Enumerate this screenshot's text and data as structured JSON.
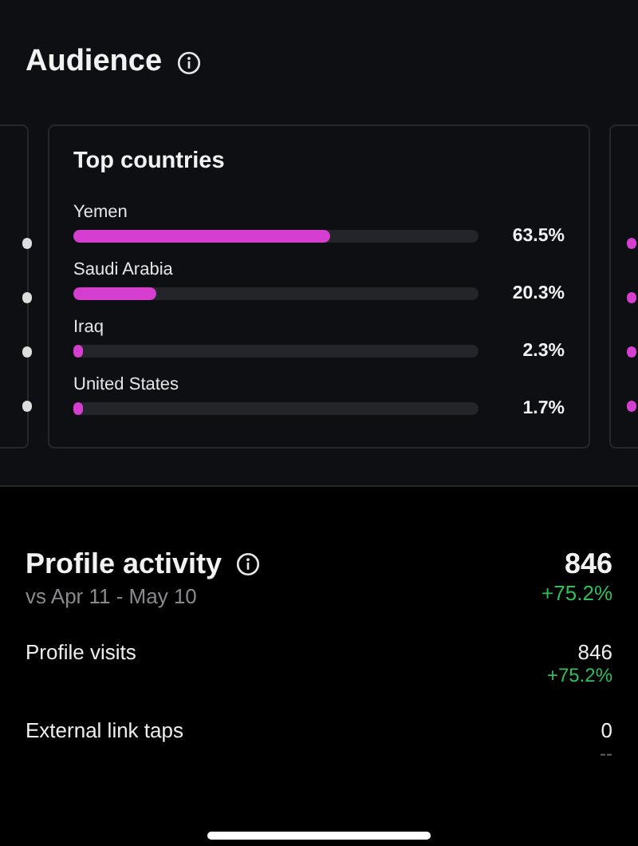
{
  "audience": {
    "title": "Audience",
    "top_countries": {
      "title": "Top countries",
      "rows": [
        {
          "name": "Yemen",
          "level": 0.635,
          "reading": "63.5%"
        },
        {
          "name": "Saudi Arabia",
          "level": 0.203,
          "reading": "20.3%"
        },
        {
          "name": "Iraq",
          "level": 0.023,
          "reading": "2.3%"
        },
        {
          "name": "United States",
          "level": 0.017,
          "reading": "1.7%"
        }
      ]
    }
  },
  "profile_activity": {
    "title": "Profile activity",
    "subtitle": "vs Apr 11 - May 10",
    "total": "846",
    "change": "+75.2%",
    "color": "#2fbf5b",
    "rows": [
      {
        "label": "Profile visits",
        "value": "846",
        "change": "+75.2%",
        "color": "#2fbf5b"
      },
      {
        "label": "External link taps",
        "value": "0",
        "change": "--",
        "color": "#6a6a6e"
      }
    ]
  }
}
